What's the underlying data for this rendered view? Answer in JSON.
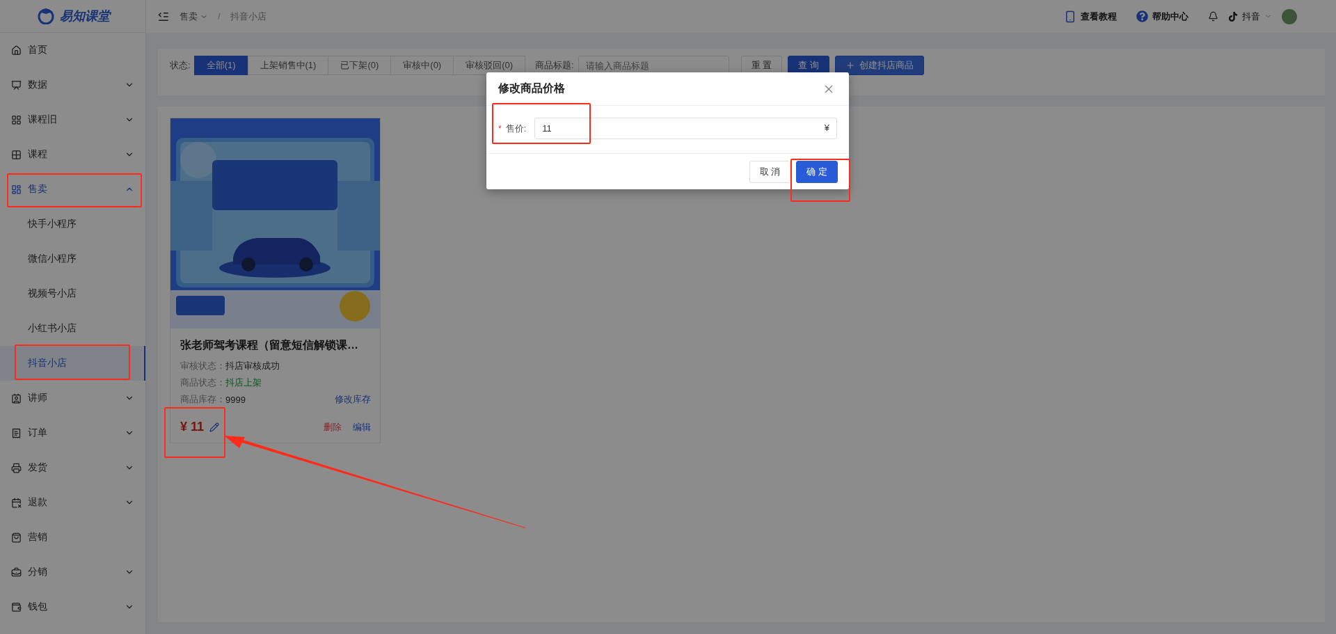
{
  "logo": {
    "text": "易知课堂"
  },
  "breadcrumb": {
    "parent": "售卖",
    "separator": "/",
    "current": "抖音小店"
  },
  "header": {
    "links": [
      "查看教程",
      "帮助中心"
    ],
    "platform": "抖音"
  },
  "sidebar": {
    "items": [
      {
        "label": "首页",
        "selected": false
      },
      {
        "label": "数据",
        "selected": false,
        "expanded": false
      },
      {
        "label": "课程旧",
        "selected": false,
        "expanded": false
      },
      {
        "label": "课程",
        "selected": false,
        "expanded": false
      },
      {
        "label": "售卖",
        "selected": true,
        "expanded": true,
        "children": [
          {
            "label": "快手小程序",
            "selected": false
          },
          {
            "label": "微信小程序",
            "selected": false
          },
          {
            "label": "视频号小店",
            "selected": false
          },
          {
            "label": "小红书小店",
            "selected": false
          },
          {
            "label": "抖音小店",
            "selected": true
          }
        ]
      },
      {
        "label": "讲师",
        "selected": false,
        "expanded": false
      },
      {
        "label": "订单",
        "selected": false,
        "expanded": false
      },
      {
        "label": "发货",
        "selected": false,
        "expanded": false
      },
      {
        "label": "退款",
        "selected": false,
        "expanded": false
      },
      {
        "label": "营销",
        "selected": false
      },
      {
        "label": "分销",
        "selected": false,
        "expanded": false
      },
      {
        "label": "钱包",
        "selected": false,
        "expanded": false
      }
    ]
  },
  "filter": {
    "status_label": "状态:",
    "tabs": [
      {
        "label": "全部(1)",
        "selected": true
      },
      {
        "label": "上架销售中(1)",
        "selected": false
      },
      {
        "label": "已下架(0)",
        "selected": false
      },
      {
        "label": "审核中(0)",
        "selected": false
      },
      {
        "label": "审核驳回(0)",
        "selected": false
      }
    ],
    "title_label": "商品标题:",
    "title_placeholder": "请输入商品标题",
    "buttons": [
      {
        "label": "重 置",
        "kind": "default"
      },
      {
        "label": "查 询",
        "kind": "primary"
      },
      {
        "label": "创建抖店商品",
        "kind": "create"
      }
    ]
  },
  "products": [
    {
      "image": {
        "kind": "picture"
      },
      "title": "张老师驾考课程（留意短信解锁课…",
      "fields": [
        {
          "label": "审核状态：",
          "value": "抖店审核成功",
          "kind": "plain"
        },
        {
          "label": "商品状态：",
          "value": "抖店上架",
          "kind": "success"
        },
        {
          "label": "商品库存：",
          "value": "9999",
          "kind": "plain",
          "action": "修改库存"
        }
      ],
      "price": "¥ 11",
      "actions": [
        {
          "label": "删除",
          "kind": "danger"
        },
        {
          "label": "编辑",
          "kind": "link"
        }
      ]
    }
  ],
  "modal": {
    "title": "修改商品价格",
    "field": {
      "required_mark": "*",
      "label": "售价:",
      "value": "11",
      "suffix": "¥"
    },
    "buttons": [
      {
        "label": "取 消",
        "kind": "default"
      },
      {
        "label": "确 定",
        "kind": "primary"
      }
    ]
  }
}
